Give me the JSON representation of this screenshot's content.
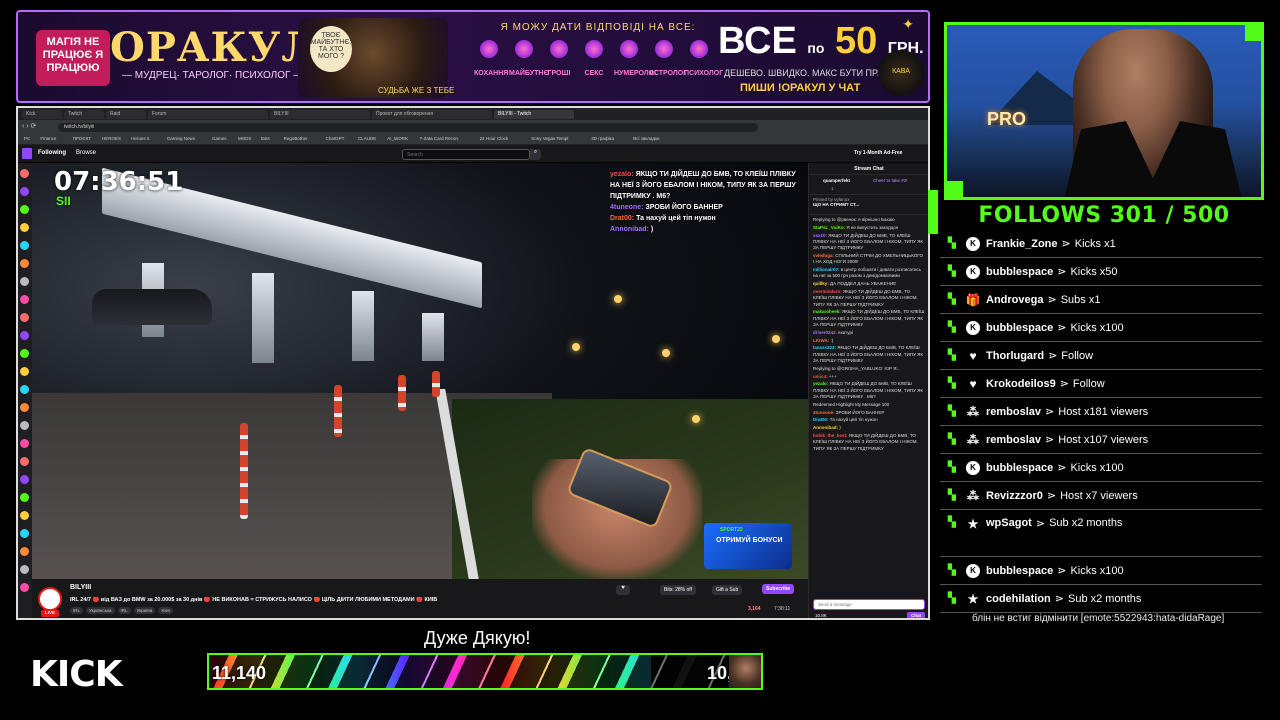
{
  "banner": {
    "magic_text": "МАГІЯ НЕ ПРАЦЮЄ Я ПРАЦЮЮ",
    "brand": "ОРАКУЛ",
    "subtitle": "— МУДРЕЦ· ТАРОЛОГ· ПСИХОЛОГ —",
    "bubble": "ТВОЄ МАЙБУТНЄ: ТА ХТО МОГО ? ",
    "bubble2": "СУДЬБА ЖЕ З ТЕБЕ",
    "tagline": "Я МОЖУ ДАТИ ВІДПОВІДІ НА ВСЕ:",
    "categories": [
      "КОХАННЯ",
      "МАЙБУТНЄ",
      "ГРОШІ",
      "СЕКС",
      "НУМЕРОЛОГ",
      "АСТРОЛОГ",
      "ПСИХОЛОГ"
    ],
    "price_all": "ВСЕ",
    "price_po": "по",
    "price_num": "50",
    "price_unit": "ГРН.",
    "cheap": "ДЕШЕВО. ШВИДКО. МАКС БУТИ ПРАВДА.",
    "write": "ПИШИ !ОРАКУЛ У ЧАТ",
    "cup_text": "КАВА",
    "accent": "#b36dff"
  },
  "browser": {
    "tabs": [
      "Kick",
      "Twitch",
      "Raid",
      "Forum",
      "BILYIII",
      "Проект для обговорення",
      "BILYIII - Twitch"
    ],
    "url": "twitch.tv/bilyiii",
    "bookmarks": [
      "PC",
      "Finance",
      "ПРОЄКТ",
      "HEROES",
      "Heroes 5",
      "Gaming News",
      "Games",
      "MODS",
      "Bots",
      "RegoBother",
      "ChatGPT",
      "CLAUDE",
      "AI_WORK",
      "7-Zata Card Recon.",
      "24 Hour Clock",
      "Sony Vegas Templ",
      "3D графіка",
      "Всі закладки"
    ],
    "nav": {
      "following": "Following",
      "browse": "Browse",
      "search_placeholder": "Search",
      "search_icon": "⌕",
      "adfree": "Try 1-Month Ad-Free"
    }
  },
  "video": {
    "clock": "07:36:51",
    "tag": "SII",
    "overlay_chat": [
      {
        "user": "yezalo:",
        "text": "ЯКЩО ТИ ДІЙДЕШ ДО БМВ, ТО КЛЕЇШ ПЛІВКУ НА НЕЇ З ЙОГО ЕБАЛОМ І НІКОМ, ТИПУ ЯК ЗА ПЕРШУ ПІДТРИМКУ . М6?"
      },
      {
        "user": "4tuneone:",
        "text": "ЗРОБИ ЙОГО БАННЕР"
      },
      {
        "user": "Drat00:",
        "text": "Та нахуй цей тіп нужон"
      },
      {
        "user": "Annonibad:",
        "text": ")"
      }
    ],
    "promo_code": "SPORT22",
    "promo_text": "ОТРИМУЙ БОНУСИ"
  },
  "stream_info": {
    "name": "BILYIII",
    "live": "LIVE",
    "title": "IRL 24/7 🔴 від ВАЗ до BMW за 20.000$ за 30 днів 🔴 НЕ ВИКОНАВ = СТРИЖУСЬ НАЛИСО 🔴 ЦІЛЬ ДІЙТИ ЛЮБИМИ МЕТОДАМИ 🔴 КИЇВ",
    "tags": [
      "IRL",
      "Українська",
      "IRL",
      "Україна",
      "Kiev"
    ],
    "heart": "♥",
    "bits": "Bits: 28% off",
    "gift": "Gift a Sub",
    "subscribe": "Subscribe",
    "viewers": "3,164",
    "uptime": "7:38:11"
  },
  "chat": {
    "header": "Stream Chat",
    "gift_user": "quamperfekt",
    "gift_count": "1",
    "gift_cheer": "Cheer to take #2!",
    "pinned_by": "Pinned by vylanox",
    "pinned_text": "ЩО НА СТРИМ? СТ...",
    "messages": [
      {
        "user": "",
        "text": "Replying to @рвенок: я вірнішно Бахаю"
      },
      {
        "user": "StaPsL_VuiKo:",
        "text": "Я не випустить закордон"
      },
      {
        "user": "xsx10:",
        "text": "ЯКЩО ТИ ДІЙДЕШ ДО БМВ, ТО КЛЕЇШ ПЛІВКУ НА НЕЇ З ЙОГО ЕБАЛОМ І НІКОМ, ТИПУ ЯК ЗА ПЕРШУ ПІДТРИМКУ"
      },
      {
        "user": "vvleduga:",
        "text": "СПІЛЬНИЙ СТРІМ ДО ХМЕЛЬНИЦЬКОГО І НА ХОД НОГИ 2000!"
      },
      {
        "user": "millionair07:",
        "text": "в центр лобшати і дивати розписатись на неї за 500 грн разом з демідоммовими"
      },
      {
        "user": "quillky:",
        "text": "ДА ПОДДЕЛ ДАНЬ УВАЖЕНИЕ"
      },
      {
        "user": "overmindern:",
        "text": "ЯКЩО ТИ ДІЙДЕШ ДО БМВ, ТО КЛЕЇШ ПЛІВКУ НА НЕЇ З ЙОГО ЕБАЛОМ І НІКОМ, ТИПУ ЯК ЗА ПЕРШУ ПІДТРИМКУ"
      },
      {
        "user": "makaroheek:",
        "text": "ЯКЩО ТИ ДІЙДЕШ ДО БМВ, ТО КЛЕЇШ ПЛІВКУ НА НЕЇ З ЙОГО ЕБАЛОМ І НІКОМ, ТИПУ ЯК ЗА ПЕРШУ ПІДТРИМКУ"
      },
      {
        "user": "driver0242:",
        "text": "вкатурі"
      },
      {
        "user": "LIGWA:",
        "text": ":)"
      },
      {
        "user": "lansss323:",
        "text": "ЯКЩО ТИ ДІЙДЕШ ДО БМВ, ТО КЛЕЇШ ПЛІВКУ НА НЕЇ З ЙОГО ЕБАЛОМ І НІКОМ, ТИПУ ЯК ЗА ПЕРШУ ПІДТРИМКУ"
      },
      {
        "user": "",
        "text": "Replying to @GRISHA_YABLUKO: ЮР Я..."
      },
      {
        "user": "umic4:",
        "text": "+++"
      },
      {
        "user": "yezalo:",
        "text": "ЯКЩО ТИ ДІЙДЕШ ДО БМВ, ТО КЛЕЇШ ПЛІВКУ НА НЕЇ З ЙОГО ЕБАЛОМ І НІКОМ, ТИПУ ЯК ЗА ПЕРШУ ПІДТРИМКУ . М6?"
      },
      {
        "user": "",
        "text": "Redeemed Highlight My Message 100"
      },
      {
        "user": "4tuneone:",
        "text": "ЗРОБИ ЙОГО БАННЕР"
      },
      {
        "user": "Drat00:",
        "text": "Та нахуй цей тіп нужон"
      },
      {
        "user": "Annonibad:",
        "text": ")"
      },
      {
        "user": "bobik_the_best:",
        "text": "ЯКЩО ТИ ДІЙДЕШ ДО БМВ, ТО КЛЕЇШ ПЛІВКУ НА НЕЇ З ЙОГО ЕБАЛОМ І НІКОМ, ТИПУ ЯК ЗА ПЕРШУ ПІДТРИМКУ"
      }
    ],
    "input_placeholder": "Send a message",
    "points": "10.8K",
    "chat_button": "Chat"
  },
  "webcam": {
    "sign": "PRO"
  },
  "follows": {
    "label": "FOLLOWS",
    "current": "301",
    "sep": "/",
    "goal": "500"
  },
  "events": [
    {
      "icon": "kick-icon",
      "user": "Frankie_Zone",
      "detail": "Kicks x1"
    },
    {
      "icon": "kick-icon",
      "user": "bubblespace",
      "detail": "Kicks x50"
    },
    {
      "icon": "gift-icon",
      "user": "Androvega",
      "detail": "Subs x1"
    },
    {
      "icon": "kick-icon",
      "user": "bubblespace",
      "detail": "Kicks x100"
    },
    {
      "icon": "heart-icon",
      "user": "Thorlugard",
      "detail": "Follow"
    },
    {
      "icon": "heart-icon",
      "user": "Krokodeilos9",
      "detail": "Follow"
    },
    {
      "icon": "host-icon",
      "user": "remboslav",
      "detail": "Host x181 viewers"
    },
    {
      "icon": "host-icon",
      "user": "remboslav",
      "detail": "Host x107 viewers"
    },
    {
      "icon": "kick-icon",
      "user": "bubblespace",
      "detail": "Kicks x100"
    },
    {
      "icon": "host-icon",
      "user": "Revizzzor0",
      "detail": "Host x7 viewers"
    },
    {
      "icon": "star-icon",
      "user": "wpSagot",
      "detail": "Sub x2 months"
    },
    {
      "icon": "kick-icon",
      "user": "bubblespace",
      "detail": "Kicks x100"
    },
    {
      "icon": "star-icon",
      "user": "codehilation",
      "detail": "Sub x2 months"
    }
  ],
  "event_note": "блін не встиг відмінити [emote:5522943:hata-didaRage]",
  "bottom": {
    "kick_logo": "KICK",
    "thanks": "Дуже Дякую!",
    "goal_left": "11,140",
    "goal_right": "10,",
    "goal_progress": 0.8
  },
  "colors": {
    "kick_green": "#53fc18",
    "twitch_purple": "#9146ff"
  }
}
